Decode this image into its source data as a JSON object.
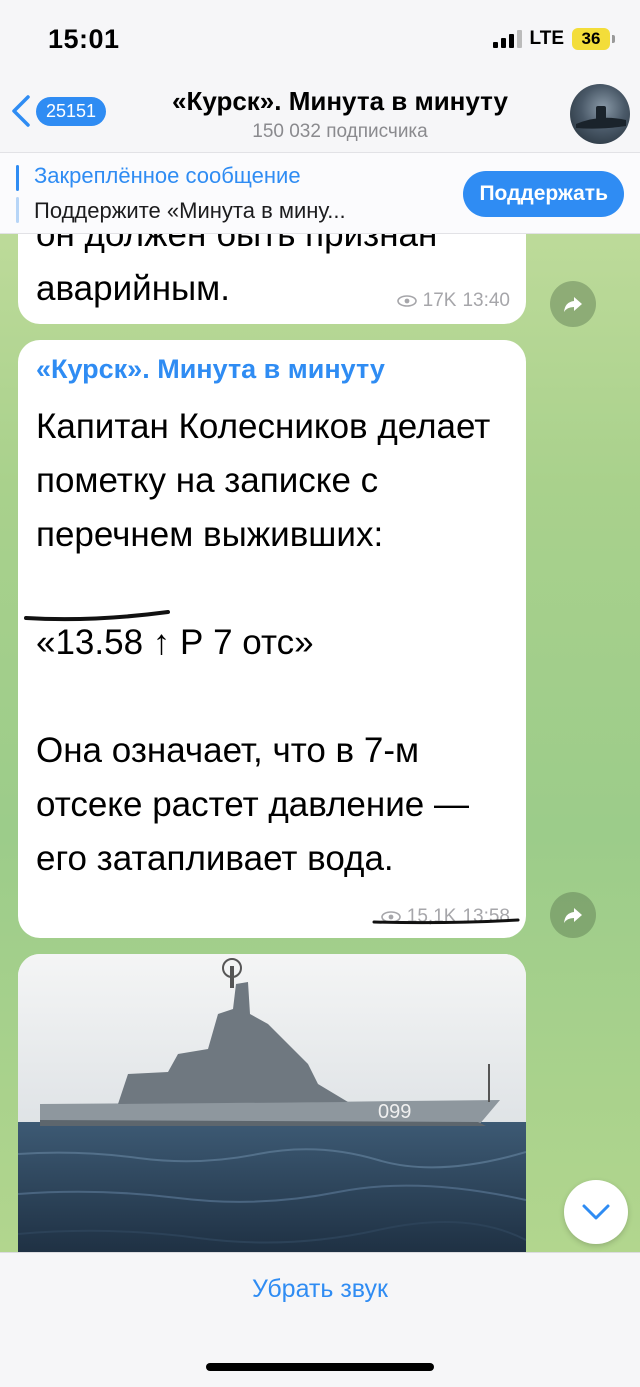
{
  "status_bar": {
    "time": "15:01",
    "network": "LTE",
    "battery": "36"
  },
  "header": {
    "back_count": "25151",
    "title": "«Курск». Минута в минуту",
    "subtitle": "150 032 подписчика"
  },
  "pinned": {
    "title": "Закреплённое сообщение",
    "text": "Поддержите «Минута в мину...",
    "button": "Поддержать"
  },
  "messages": [
    {
      "text_lines": [
        "он должен быть признан",
        "аварийным."
      ],
      "views": "17K",
      "time": "13:40"
    },
    {
      "author": "«Курск». Минута в минуту",
      "paragraphs": [
        "Капитан Колесников делает пометку на записке с перечнем выживших:",
        "«13.58 ↑ Р 7 отс»",
        "Она означает, что в 7-м отсеке растет давление — его затапливает вода."
      ],
      "views": "15,1K",
      "time": "13:58"
    }
  ],
  "photo": {
    "hull_number": "099"
  },
  "bottom": {
    "mute_label": "Убрать звук"
  },
  "colors": {
    "accent": "#2f8cf3",
    "bubble": "#ffffff",
    "wallpaper": "#a9d18c"
  }
}
